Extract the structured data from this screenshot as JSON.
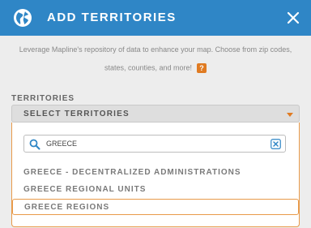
{
  "header": {
    "title": "ADD TERRITORIES"
  },
  "description": {
    "line1": "Leverage Mapline's repository of data to enhance your map. Choose from zip codes,",
    "line2": "states, counties, and more!",
    "help_label": "?"
  },
  "territories": {
    "section_label": "TERRITORIES",
    "select_label": "SELECT TERRITORIES",
    "search_value": "GREECE",
    "options": [
      "GREECE - DECENTRALIZED ADMINISTRATIONS",
      "GREECE REGIONAL UNITS",
      "GREECE REGIONS"
    ],
    "selected_index": 2
  },
  "colors": {
    "header": "#2f86c6",
    "accent": "#e07b22",
    "panel": "#ededed"
  }
}
